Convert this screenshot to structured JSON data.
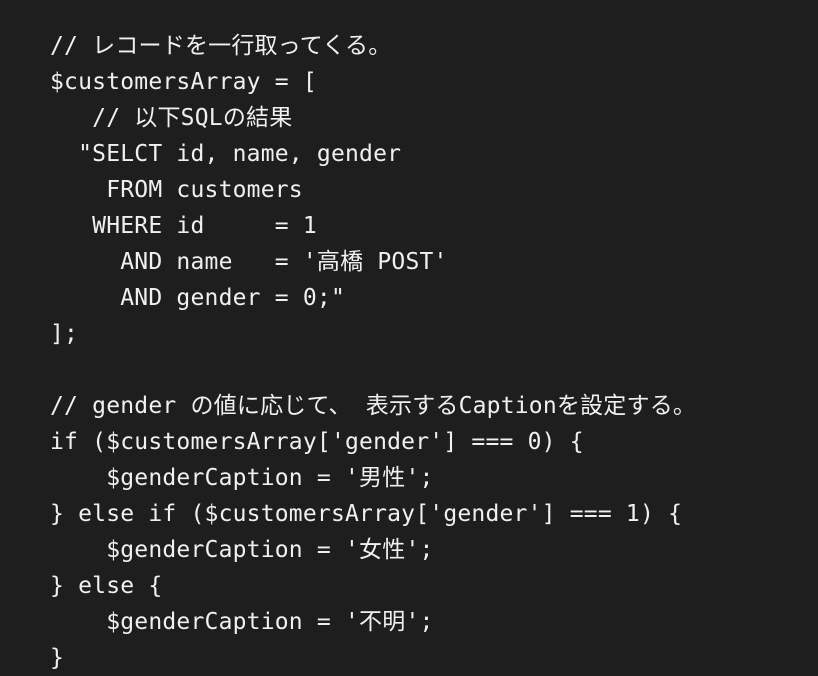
{
  "editor": {
    "lines": [
      "// レコードを一行取ってくる。",
      "$customersArray = [",
      "   // 以下SQLの結果",
      "  \"SELCT id, name, gender",
      "    FROM customers",
      "   WHERE id     = 1",
      "     AND name   = '高橋 POST'",
      "     AND gender = 0;\"",
      "];",
      "",
      "// gender の値に応じて、 表示するCaptionを設定する。",
      "if ($customersArray['gender'] === 0) {",
      "    $genderCaption = '男性';",
      "} else if ($customersArray['gender'] === 1) {",
      "    $genderCaption = '女性';",
      "} else {",
      "    $genderCaption = '不明';",
      "}"
    ]
  }
}
